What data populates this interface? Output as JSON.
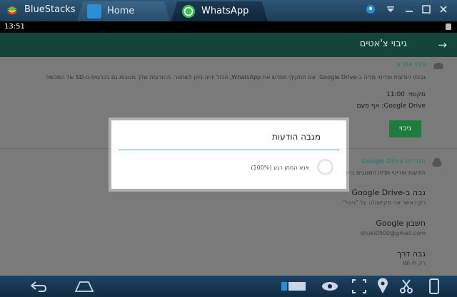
{
  "emulator": {
    "name": "BlueStacks",
    "tabs": [
      {
        "label": "Home"
      },
      {
        "label": "WhatsApp"
      }
    ]
  },
  "statusbar": {
    "time": "13:51"
  },
  "appbar": {
    "title": "גיבוי צ'אטים"
  },
  "settings": {
    "last_backup": {
      "title": "גיבוי אחרון",
      "description": "גבה/י הודעות ופריטי מדיה ב-Google Drive. אם תתקין/י מחדש את WhatsApp, הכול יהיה ניתן לשחזור. ההודעות שלך מגובות גם בכרטיס ה-SD של המכשיר",
      "local": "מקומי: 11:00",
      "drive": "Google Drive: אף פעם",
      "button": "גיבוי"
    },
    "drive_settings": {
      "title": "הגדרות Google Drive",
      "description": "הודעות ופריטי מדיה המגובים ב-Google Drive"
    },
    "backup_to_drive": {
      "title": "גבה ב-Google Drive",
      "subtitle": "רק כאשר אני מקישה/ה על \"גיבוי\""
    },
    "account": {
      "title": "חשבון Google",
      "value": "shuki0500@gmail.com"
    },
    "backup_via": {
      "title": "גבה דרך",
      "value": "רק Wi-Fi"
    }
  },
  "dialog": {
    "title": "מגבה הודעות",
    "progress_text": "אנא המתן רגע (100%)"
  },
  "colors": {
    "appbar": "#13453b",
    "titlebar": "#2e5677",
    "button": "#1d7d3e",
    "accent": "#4fa5c2"
  }
}
